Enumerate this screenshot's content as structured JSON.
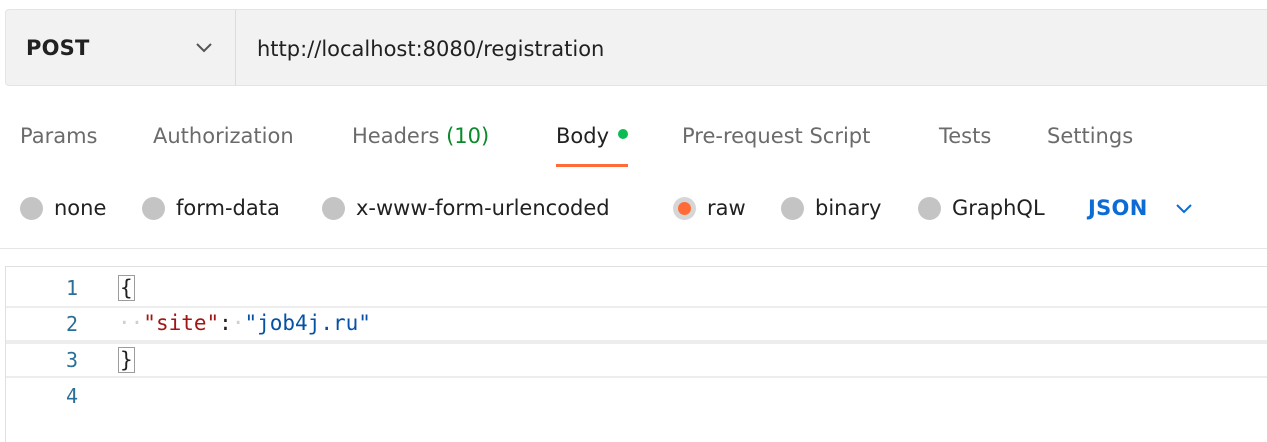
{
  "request": {
    "method": "POST",
    "url": "http://localhost:8080/registration"
  },
  "tabs": [
    {
      "label": "Params"
    },
    {
      "label": "Authorization"
    },
    {
      "label": "Headers",
      "count": "(10)"
    },
    {
      "label": "Body",
      "active": true
    },
    {
      "label": "Pre-request Script"
    },
    {
      "label": "Tests"
    },
    {
      "label": "Settings"
    }
  ],
  "body_types": [
    {
      "label": "none",
      "selected": false
    },
    {
      "label": "form-data",
      "selected": false
    },
    {
      "label": "x-www-form-urlencoded",
      "selected": false
    },
    {
      "label": "raw",
      "selected": true
    },
    {
      "label": "binary",
      "selected": false
    },
    {
      "label": "GraphQL",
      "selected": false
    }
  ],
  "language": "JSON",
  "editor": {
    "line_numbers": [
      "1",
      "2",
      "3",
      "4"
    ],
    "open_brace": "{",
    "close_brace": "}",
    "indent_dots": "··",
    "key": "\"site\"",
    "colon": ":",
    "space_dot": "·",
    "value": "\"job4j.ru\""
  },
  "colors": {
    "accent": "#ff6c37",
    "status_dot": "#0cbb52",
    "header_count": "#0a8a2a",
    "language": "#0d6bd6",
    "json_key": "#a31515",
    "json_string": "#0451a5",
    "line_number": "#2a6f97"
  },
  "icons": {
    "method_dropdown": "chevron-down-icon",
    "language_dropdown": "chevron-down-icon"
  }
}
